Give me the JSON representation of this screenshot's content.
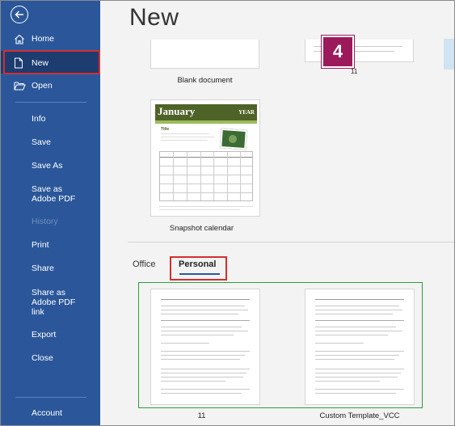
{
  "sidebar": {
    "items": [
      {
        "label": "Home"
      },
      {
        "label": "New"
      },
      {
        "label": "Open"
      },
      {
        "label": "Info"
      },
      {
        "label": "Save"
      },
      {
        "label": "Save As"
      },
      {
        "label": "Save as Adobe PDF"
      },
      {
        "label": "History"
      },
      {
        "label": "Print"
      },
      {
        "label": "Share"
      },
      {
        "label": "Share as Adobe PDF link"
      },
      {
        "label": "Export"
      },
      {
        "label": "Close"
      },
      {
        "label": "Account"
      }
    ]
  },
  "main": {
    "title": "New",
    "step_badge": "4",
    "templates": [
      {
        "label": "Blank document"
      },
      {
        "label": "11"
      },
      {
        "label": "Snapshot calendar"
      }
    ],
    "calendar_preview": {
      "month": "January",
      "year": "YEAR",
      "title": "Title"
    },
    "tabs": [
      {
        "label": "Office"
      },
      {
        "label": "Personal"
      }
    ],
    "personal_templates": [
      {
        "label": "11"
      },
      {
        "label": "Custom Template_VCC"
      }
    ]
  },
  "colors": {
    "sidebar": "#2b579a",
    "highlight_box": "#d32f2f",
    "group_box": "#2e9e3e",
    "badge": "#9c1a5b"
  }
}
